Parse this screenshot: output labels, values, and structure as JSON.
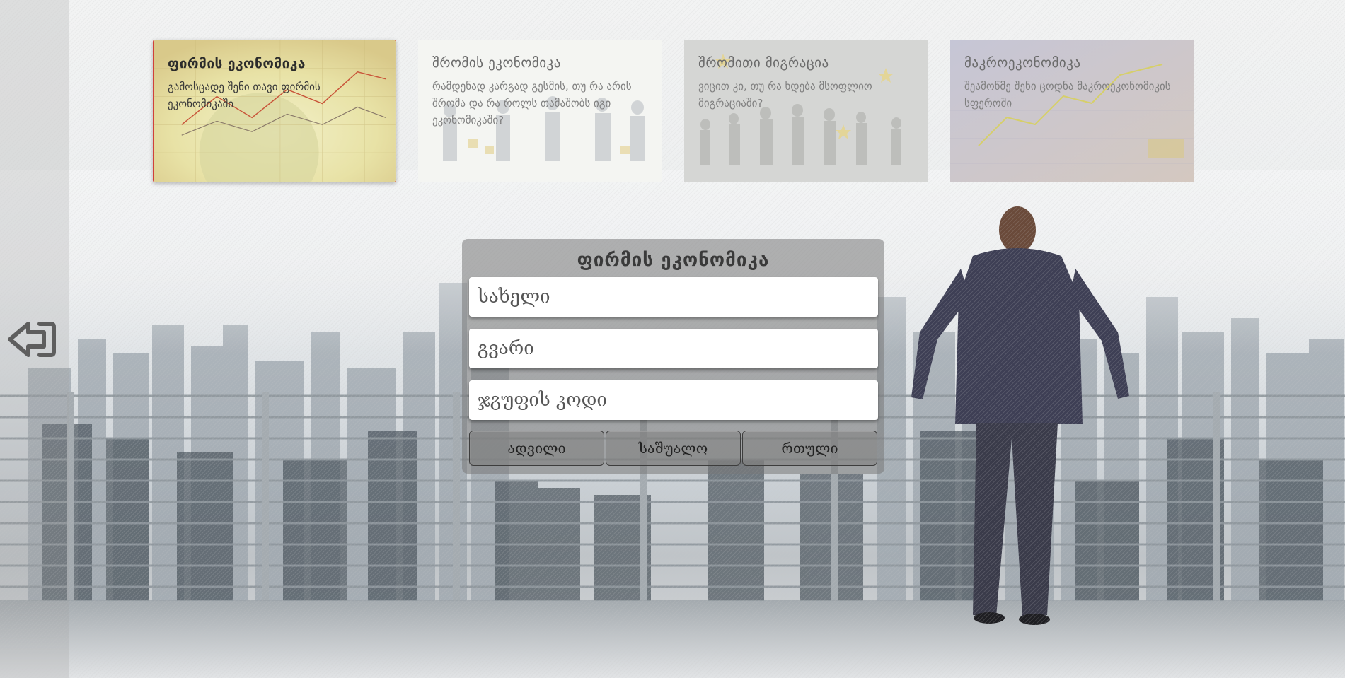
{
  "cards": [
    {
      "title": "ფირმის ეკონომიკა",
      "description": "გამოსცადე შენი თავი ფირმის ეკონომიკაში",
      "state": "active"
    },
    {
      "title": "შრომის ეკონომიკა",
      "description": "რამდენად კარგად გესმის, თუ რა არის შრომა და რა როლს თამაშობს იგი ეკონომიკაში?",
      "state": "dim"
    },
    {
      "title": "შრომითი მიგრაცია",
      "description": "ვიცით კი, თუ რა ხდება მსოფლიო მიგრაციაში?",
      "state": "dim"
    },
    {
      "title": "მაკროეკონომიკა",
      "description": "შეამოწმე შენი ცოდნა მაკროეკონომიკის სფეროში",
      "state": "dim"
    }
  ],
  "form": {
    "title": "ფირმის ეკონომიკა",
    "first_name_placeholder": "სახელი",
    "last_name_placeholder": "გვარი",
    "group_code_placeholder": "ჯგუფის კოდი",
    "levels": [
      "ადვილი",
      "საშუალო",
      "რთული"
    ]
  },
  "icons": {
    "logout": "logout-icon"
  },
  "colors": {
    "active_card_border": "#d0403a",
    "panel_bg": "#787878"
  }
}
